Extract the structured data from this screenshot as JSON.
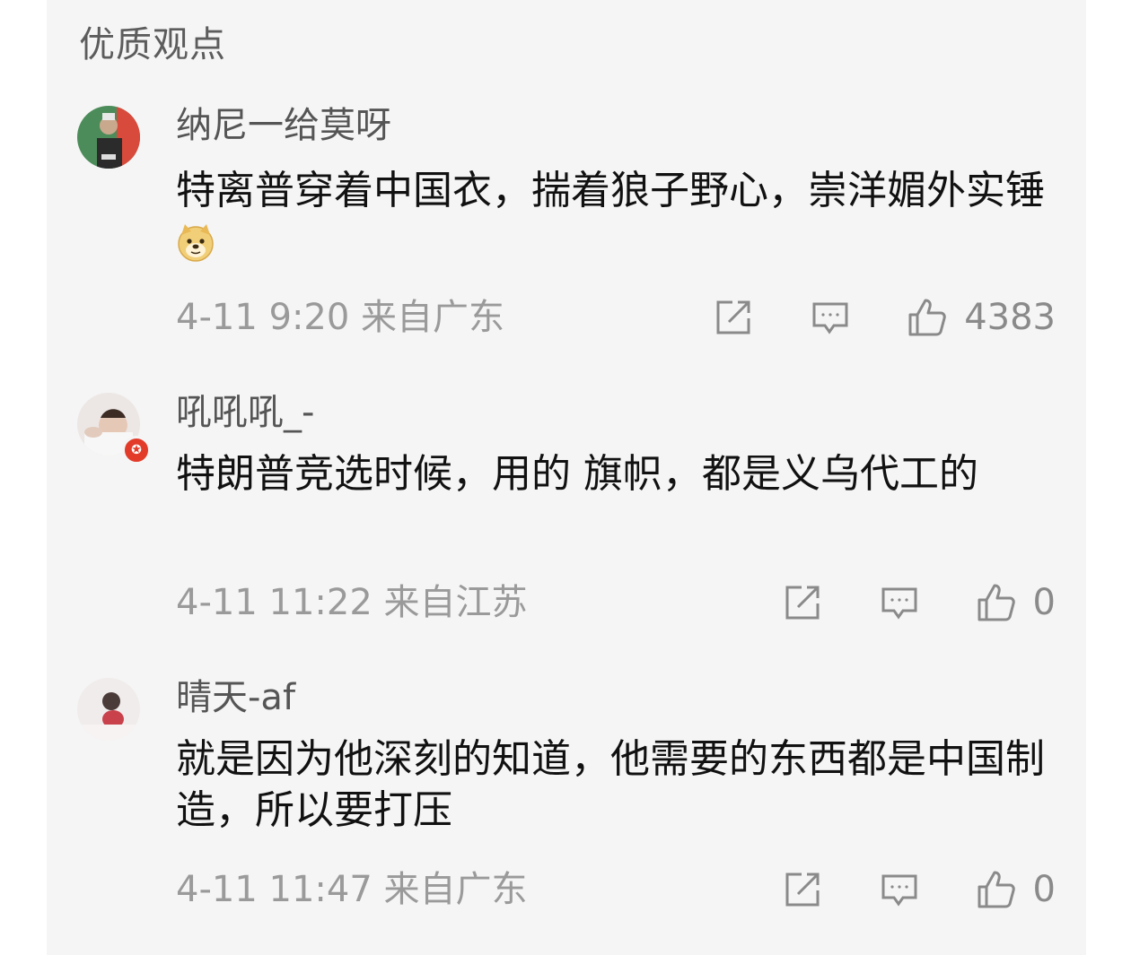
{
  "section": {
    "title": "优质观点"
  },
  "comments": [
    {
      "username": "纳尼一给莫呀",
      "content": "特离普穿着中国衣，揣着狼子野心，崇洋媚外实锤",
      "emoji": "doge-emoji",
      "timestamp": "4-11 9:20 来自广东",
      "likes": "4383",
      "vip": false
    },
    {
      "username": "吼吼吼_-",
      "content": "特朗普竞选时候，用的 旗帜，都是义乌代工的",
      "timestamp": "4-11 11:22 来自江苏",
      "likes": "0",
      "vip": true
    },
    {
      "username": "晴天-af",
      "content": "就是因为他深刻的知道，他需要的东西都是中国制造，所以要打压",
      "timestamp": "4-11 11:47 来自广东",
      "likes": "0",
      "vip": false
    }
  ],
  "icons": {
    "share": "share-icon",
    "comment": "comment-icon",
    "like": "thumbs-up-icon"
  },
  "colors": {
    "panel_bg": "#f5f5f5",
    "username": "#555555",
    "content": "#111111",
    "meta": "#9a9a9a",
    "vip_badge": "#e23b2a"
  }
}
